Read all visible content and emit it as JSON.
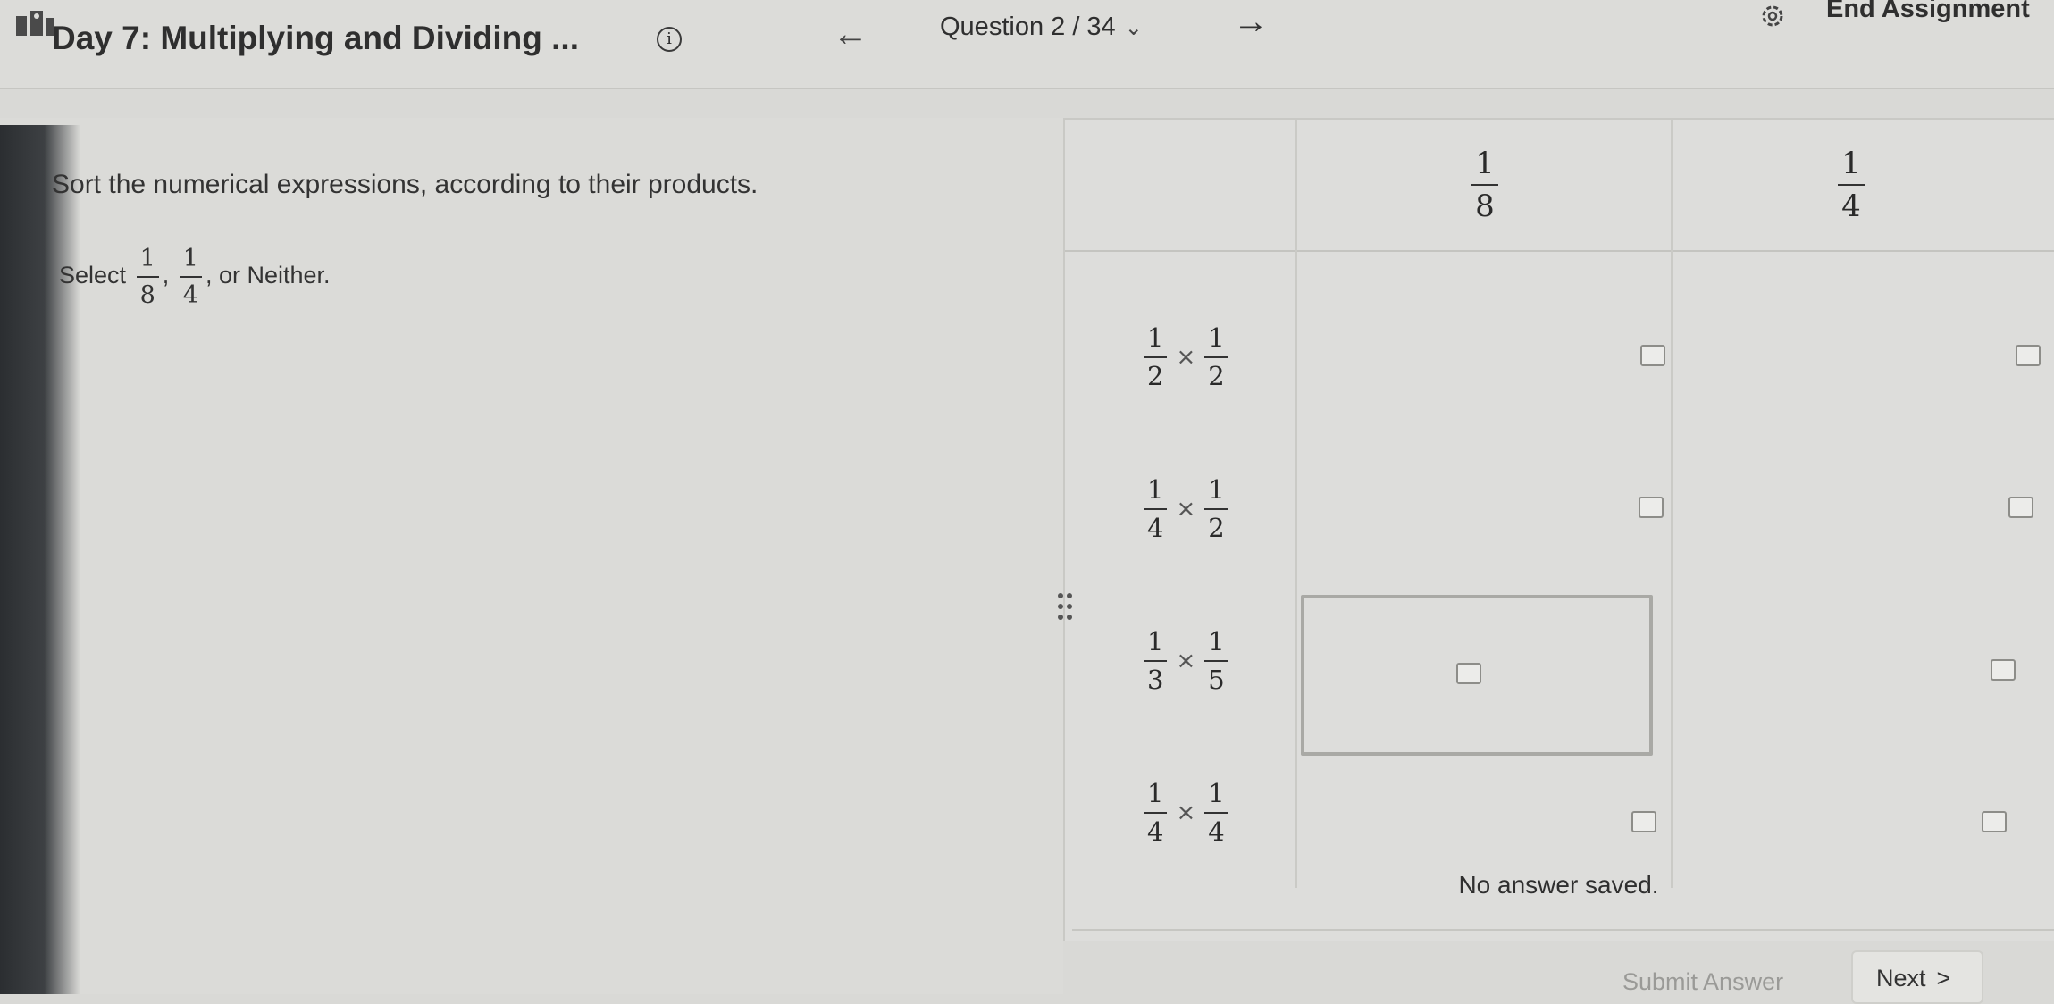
{
  "header": {
    "title": "Day 7: Multiplying and Dividing ...",
    "info_icon": "info-icon",
    "info_glyph": "i",
    "prev_arrow": "←",
    "question_label": "Question 2 / 34",
    "question_chevron": "⌄",
    "next_arrow": "→",
    "settings_icon": "gear-icon",
    "end_label": "End Assignment"
  },
  "prompt": {
    "text": "Sort the numerical expressions, according to their products.",
    "select_prefix": "Select",
    "select_frac1": {
      "num": "1",
      "den": "8"
    },
    "select_sep": ",",
    "select_frac2": {
      "num": "1",
      "den": "4"
    },
    "select_suffix": ", or Neither."
  },
  "grid": {
    "columns": [
      {
        "num": "1",
        "den": "8"
      },
      {
        "num": "1",
        "den": "4"
      }
    ],
    "times": "×",
    "rows": [
      {
        "a": {
          "num": "1",
          "den": "2"
        },
        "b": {
          "num": "1",
          "den": "2"
        }
      },
      {
        "a": {
          "num": "1",
          "den": "4"
        },
        "b": {
          "num": "1",
          "den": "2"
        }
      },
      {
        "a": {
          "num": "1",
          "den": "3"
        },
        "b": {
          "num": "1",
          "den": "5"
        }
      },
      {
        "a": {
          "num": "1",
          "den": "4"
        },
        "b": {
          "num": "1",
          "den": "4"
        }
      }
    ],
    "status": "No answer saved."
  },
  "footer": {
    "submit_label": "Submit Answer",
    "next_label": "Next",
    "next_chevron": ">"
  },
  "colors": {
    "page_bg": "#d9d9d6",
    "text": "#2f2f2f",
    "checkbox_border": "#8d8d89"
  }
}
